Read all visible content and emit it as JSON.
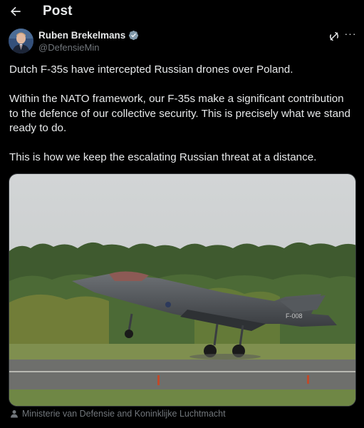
{
  "topbar": {
    "back_icon": "arrow-left-icon",
    "title": "Post"
  },
  "author": {
    "display_name": "Ruben Brekelmans",
    "handle": "@DefensieMin",
    "verified_icon": "verified-badge-icon",
    "verified_color": "#829aab"
  },
  "actions": {
    "grok_icon": "grok-icon",
    "more_label": "···"
  },
  "tweet": {
    "paragraphs": [
      "Dutch F-35s have intercepted Russian drones over Poland.",
      "Within the NATO framework, our F-35s make a significant contribution to the defence of our collective security. This is precisely what we stand ready to do.",
      "This is how we keep the escalating Russian threat at a distance."
    ]
  },
  "media": {
    "tail_code": "F-008"
  },
  "credit": {
    "icon": "person-icon",
    "text": "Ministerie van Defensie and Koninklijke Luchtmacht"
  },
  "colors": {
    "background": "#000000",
    "text_primary": "#e7e9ea",
    "text_secondary": "#71767b"
  }
}
